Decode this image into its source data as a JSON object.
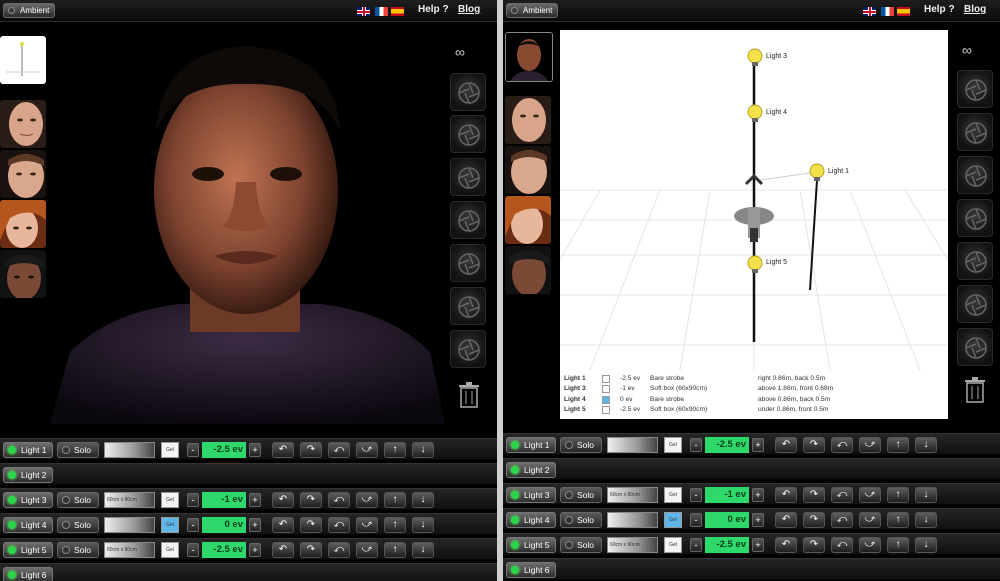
{
  "header": {
    "ambient_label": "Ambient",
    "help_label": "Help ?",
    "blog_label": "Blog",
    "flags": [
      "uk-flag",
      "fr-flag",
      "es-flag"
    ]
  },
  "left": {
    "rows": [
      {
        "label": "Light 1",
        "solo": "Solo",
        "gel": "Gel",
        "ev": "-2.5 ev",
        "modifier": "",
        "gel_color": "#f4f4f4",
        "full": true
      },
      {
        "label": "Light 2",
        "full": false
      },
      {
        "label": "Light 3",
        "solo": "Solo",
        "gel": "Gel",
        "ev": "-1 ev",
        "modifier": "60cm x 90cm",
        "gel_color": "#f4f4f4",
        "full": true
      },
      {
        "label": "Light 4",
        "solo": "Solo",
        "gel": "Gel",
        "ev": "0 ev",
        "modifier": "",
        "gel_color": "#5fb6e8",
        "full": true
      },
      {
        "label": "Light 5",
        "solo": "Solo",
        "gel": "Gel",
        "ev": "-2.5 ev",
        "modifier": "60cm x 90cm",
        "gel_color": "#f4f4f4",
        "full": true
      },
      {
        "label": "Light 6",
        "full": false
      }
    ]
  },
  "right": {
    "rows": [
      {
        "label": "Light 1",
        "solo": "Solo",
        "gel": "Gel",
        "ev": "-2.5 ev",
        "modifier": "",
        "gel_color": "#f4f4f4",
        "full": true
      },
      {
        "label": "Light 2",
        "full": false
      },
      {
        "label": "Light 3",
        "solo": "Solo",
        "gel": "Gel",
        "ev": "-1 ev",
        "modifier": "60cm x 90cm",
        "gel_color": "#f4f4f4",
        "full": true
      },
      {
        "label": "Light 4",
        "solo": "Solo",
        "gel": "Gel",
        "ev": "0 ev",
        "modifier": "",
        "gel_color": "#5fb6e8",
        "full": true
      },
      {
        "label": "Light 5",
        "solo": "Solo",
        "gel": "Gel",
        "ev": "-2.5 ev",
        "modifier": "60cm x 90cm",
        "gel_color": "#f4f4f4",
        "full": true
      },
      {
        "label": "Light 6",
        "full": false
      }
    ],
    "scene": {
      "bulbs": [
        {
          "label": "Light 3"
        },
        {
          "label": "Light 4"
        },
        {
          "label": "Light 1"
        },
        {
          "label": "Light 5"
        }
      ],
      "legend": [
        {
          "light": "Light 1",
          "ev": "-2.5 ev",
          "type": "Bare strobe",
          "pos": "right 0.86m, back 0.5m",
          "swatch": "#ffffff"
        },
        {
          "light": "Light 3",
          "ev": "-1 ev",
          "type": "Soft box (60x90cm)",
          "pos": "above 1.88m, front 0.68m",
          "swatch": "#ffffff"
        },
        {
          "light": "Light 4",
          "ev": "0 ev",
          "type": "Bare strobe",
          "pos": "above 0.86m, back 0.5m",
          "swatch": "#5fb6e8"
        },
        {
          "light": "Light 5",
          "ev": "-2.5 ev",
          "type": "Soft box (60x90cm)",
          "pos": "under 0.86m, front 0.5m",
          "swatch": "#ffffff"
        }
      ]
    }
  },
  "colors": {
    "ev_green": "#2fd86a",
    "led_green": "#2bd44a",
    "gel_blue": "#5fb6e8"
  }
}
